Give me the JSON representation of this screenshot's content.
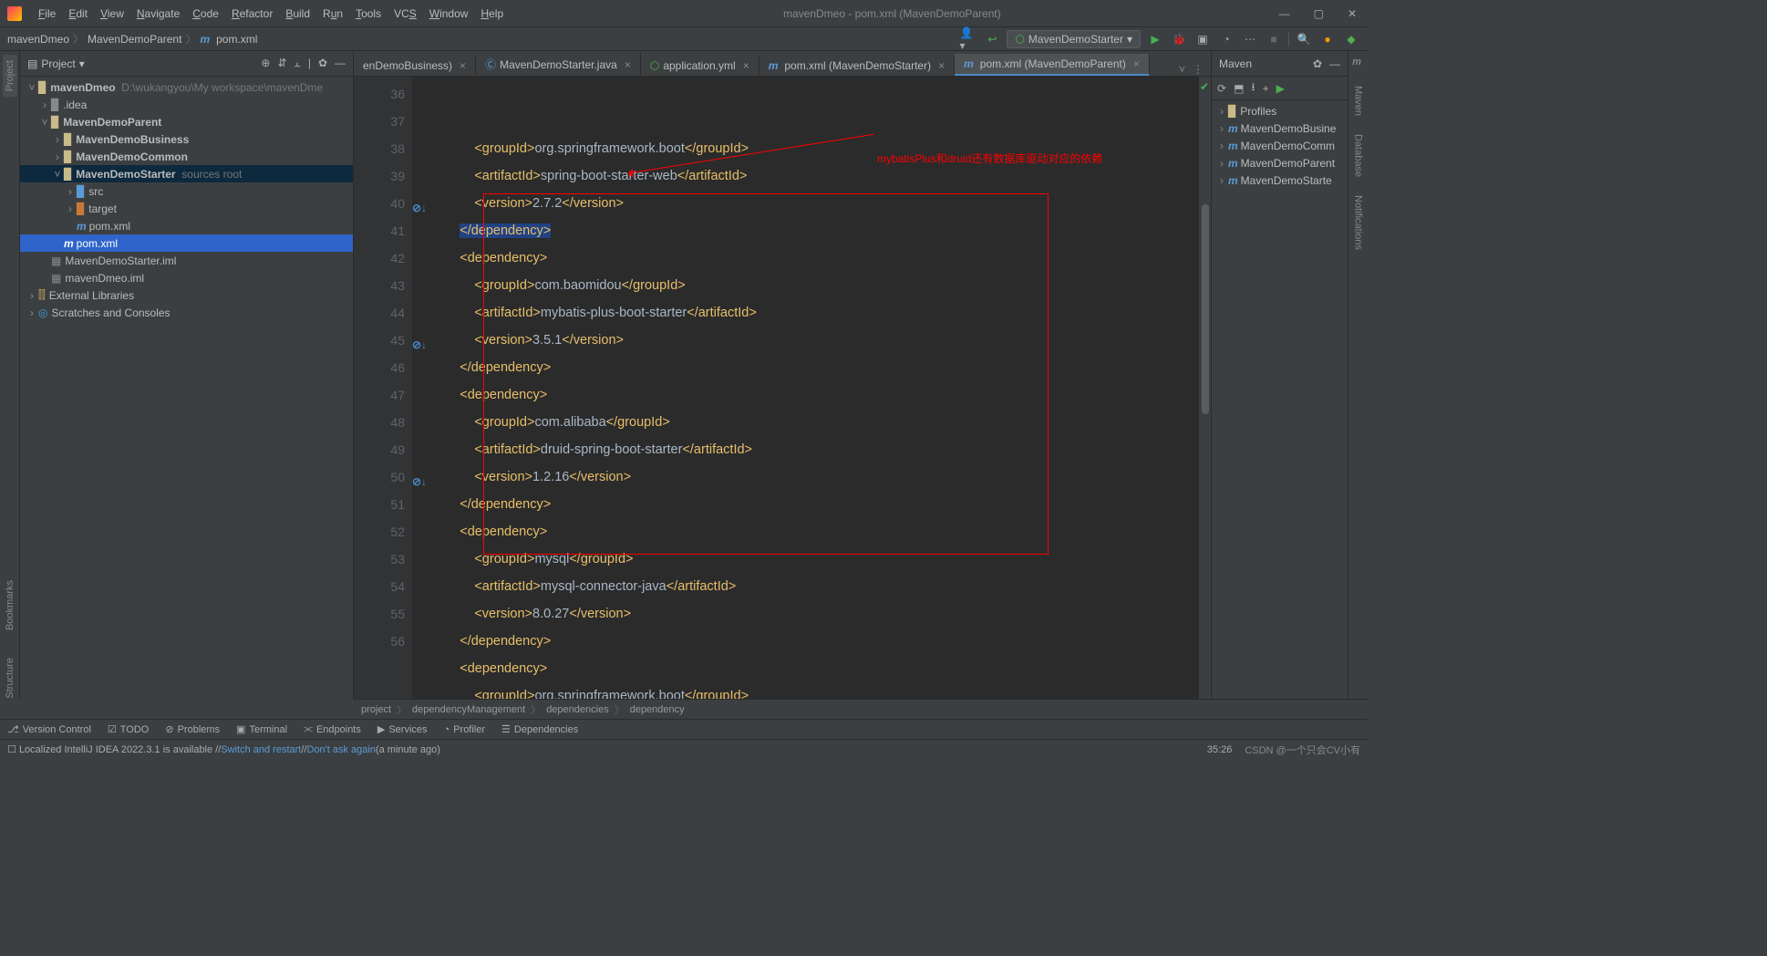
{
  "window": {
    "title": "mavenDmeo - pom.xml (MavenDemoParent)"
  },
  "menu": [
    "File",
    "Edit",
    "View",
    "Navigate",
    "Code",
    "Refactor",
    "Build",
    "Run",
    "Tools",
    "VCS",
    "Window",
    "Help"
  ],
  "breadcrumb": {
    "p1": "mavenDmeo",
    "p2": "MavenDemoParent",
    "p3": "pom.xml"
  },
  "runconfig": "MavenDemoStarter",
  "project": {
    "title": "Project",
    "root": "mavenDmeo",
    "rootPath": "D:\\wukangyou\\My workspace\\mavenDme",
    "idea": ".idea",
    "parent": "MavenDemoParent",
    "business": "MavenDemoBusiness",
    "common": "MavenDemoCommon",
    "starter": "MavenDemoStarter",
    "starterHint": "sources root",
    "src": "src",
    "target": "target",
    "starterPom": "pom.xml",
    "parentPom": "pom.xml",
    "starterIml": "MavenDemoStarter.iml",
    "rootIml": "mavenDmeo.iml",
    "extlib": "External Libraries",
    "scratches": "Scratches and Consoles"
  },
  "tabs": {
    "t1": "enDemoBusiness)",
    "t2": "MavenDemoStarter.java",
    "t3": "application.yml",
    "t4": "pom.xml (MavenDemoStarter)",
    "t5": "pom.xml (MavenDemoParent)"
  },
  "maven": {
    "title": "Maven",
    "profiles": "Profiles",
    "m1": "MavenDemoBusine",
    "m2": "MavenDemoComm",
    "m3": "MavenDemoParent",
    "m4": "MavenDemoStarte"
  },
  "sideTabs": {
    "left1": "Project",
    "left2": "Bookmarks",
    "left3": "Structure",
    "right1": "Maven",
    "right2": "Database",
    "right3": "Notifications"
  },
  "annotation": "mybatisPlus和druid还有数据库驱动对应的依赖",
  "code": {
    "lines": [
      36,
      37,
      38,
      39,
      40,
      41,
      42,
      43,
      44,
      45,
      46,
      47,
      48,
      49,
      50,
      51,
      52,
      53,
      54,
      55,
      56
    ],
    "l36": {
      "pre": "            ",
      "a": "<groupId>",
      "b": "org.springframework.boot",
      "c": "</groupId>"
    },
    "l37": {
      "pre": "            ",
      "a": "<artifactId>",
      "b": "spring-boot-starter-web",
      "c": "</artifactId>"
    },
    "l38": {
      "pre": "            ",
      "a": "<version>",
      "b": "2.7.2",
      "c": "</version>"
    },
    "l39": {
      "pre": "        ",
      "a": "</dependency>"
    },
    "l40": {
      "pre": "        ",
      "a": "<dependency>"
    },
    "l41": {
      "pre": "            ",
      "a": "<groupId>",
      "b": "com.baomidou",
      "c": "</groupId>"
    },
    "l42": {
      "pre": "            ",
      "a": "<artifactId>",
      "b": "mybatis-plus-boot-starter",
      "c": "</artifactId>"
    },
    "l43": {
      "pre": "            ",
      "a": "<version>",
      "b": "3.5.1",
      "c": "</version>"
    },
    "l44": {
      "pre": "        ",
      "a": "</dependency>"
    },
    "l45": {
      "pre": "        ",
      "a": "<dependency>"
    },
    "l46": {
      "pre": "            ",
      "a": "<groupId>",
      "b": "com.alibaba",
      "c": "</groupId>"
    },
    "l47": {
      "pre": "            ",
      "a": "<artifactId>",
      "b": "druid-spring-boot-starter",
      "c": "</artifactId>"
    },
    "l48": {
      "pre": "            ",
      "a": "<version>",
      "b": "1.2.16",
      "c": "</version>"
    },
    "l49": {
      "pre": "        ",
      "a": "</dependency>"
    },
    "l50": {
      "pre": "        ",
      "a": "<dependency>"
    },
    "l51": {
      "pre": "            ",
      "a": "<groupId>",
      "b": "mysql",
      "c": "</groupId>"
    },
    "l52": {
      "pre": "            ",
      "a": "<artifactId>",
      "b": "mysql-connector-java",
      "c": "</artifactId>"
    },
    "l53": {
      "pre": "            ",
      "a": "<version>",
      "b": "8.0.27",
      "c": "</version>"
    },
    "l54": {
      "pre": "        ",
      "a": "</dependency>"
    },
    "l55": {
      "pre": "        ",
      "a": "<dependency>"
    },
    "l56": {
      "pre": "            ",
      "a": "<groupId>",
      "b": "org.springframework.boot",
      "c": "</groupId>"
    }
  },
  "breadcrumb2": [
    "project",
    "dependencyManagement",
    "dependencies",
    "dependency"
  ],
  "bottom": {
    "vc": "Version Control",
    "todo": "TODO",
    "problems": "Problems",
    "terminal": "Terminal",
    "endpoints": "Endpoints",
    "services": "Services",
    "profiler": "Profiler",
    "deps": "Dependencies"
  },
  "status": {
    "msg": "Localized IntelliJ IDEA 2022.3.1 is available // ",
    "l1": "Switch and restart",
    "sep": " // ",
    "l2": "Don't ask again",
    "age": " (a minute ago)",
    "pos": "35:26",
    "wm": "CSDN @一个只会CV小有"
  }
}
